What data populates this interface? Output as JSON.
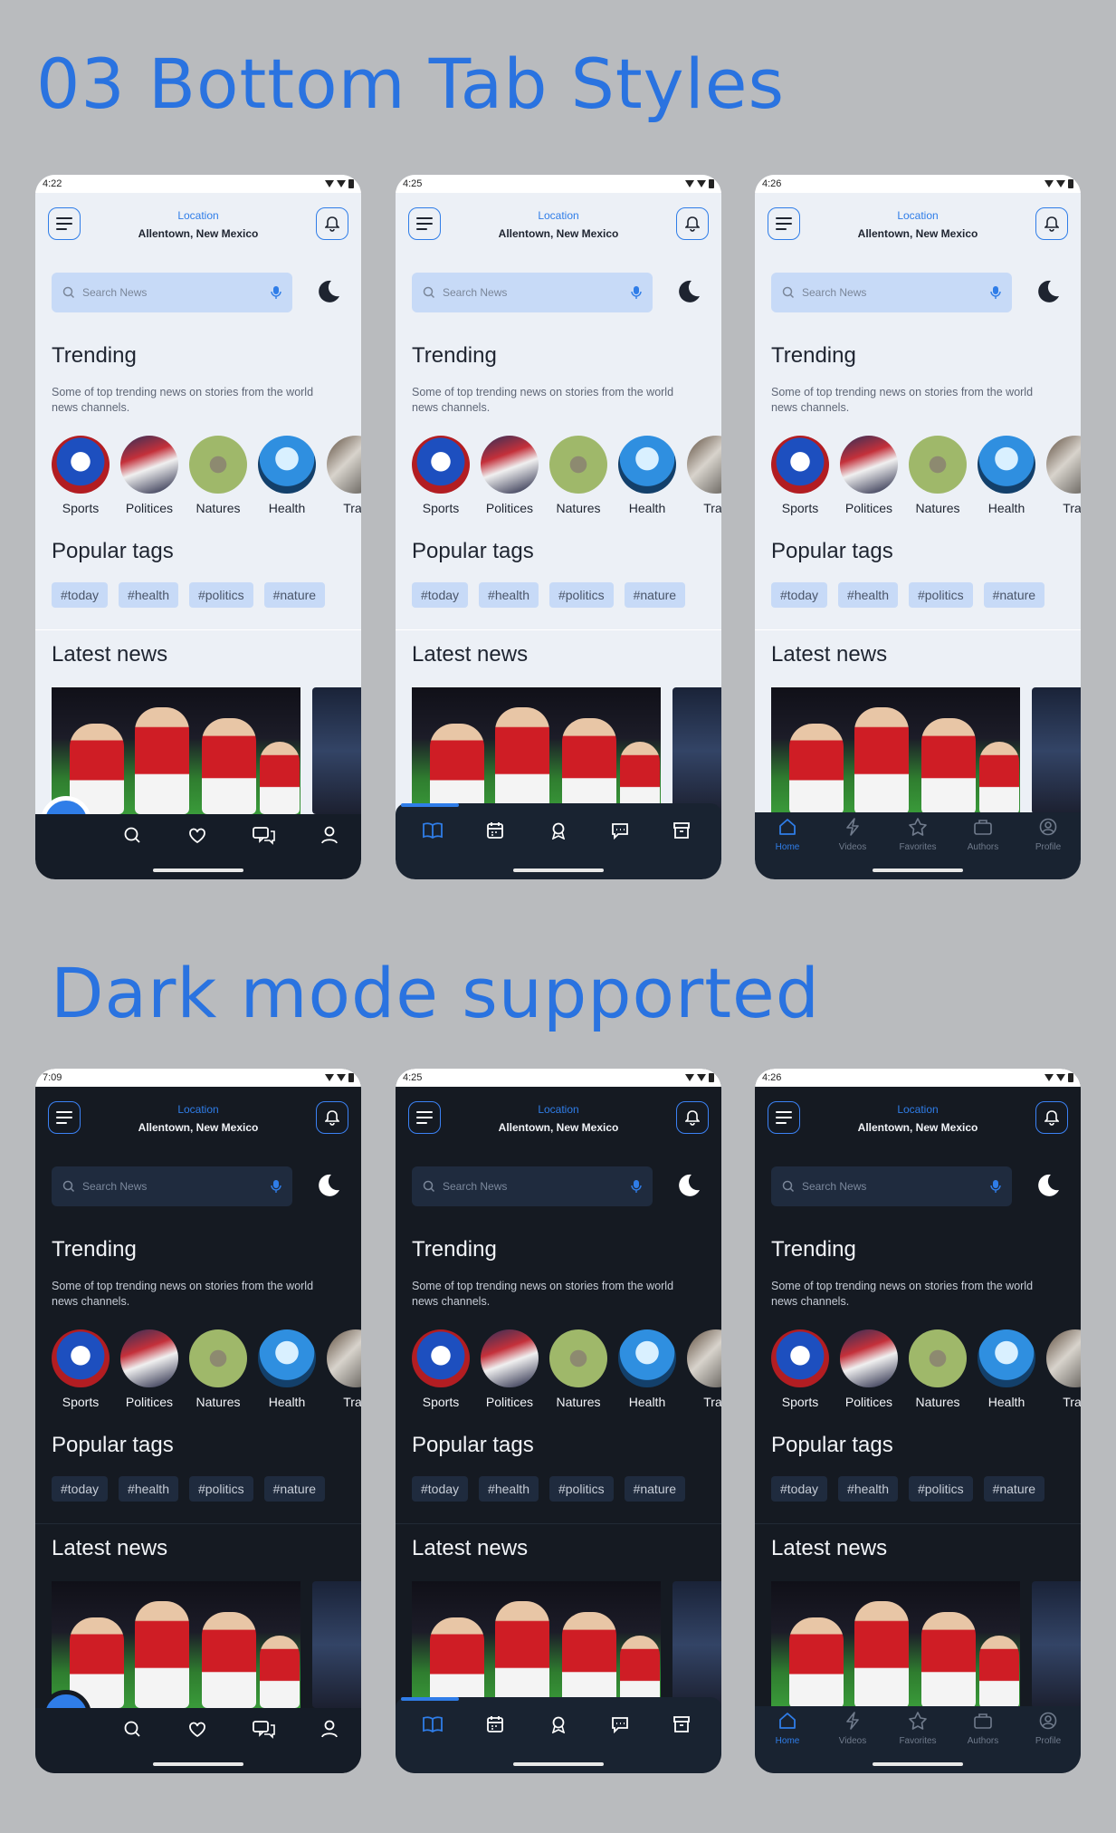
{
  "headings": {
    "tab_styles": "03 Bottom Tab Styles",
    "dark_mode": "Dark mode supported"
  },
  "screens": [
    {
      "time": "4:22"
    },
    {
      "time": "4:25"
    },
    {
      "time": "4:26"
    },
    {
      "time": "7:09"
    },
    {
      "time": "4:25"
    },
    {
      "time": "4:26"
    }
  ],
  "header": {
    "location_label": "Location",
    "location_value": "Allentown, New Mexico"
  },
  "search": {
    "placeholder": "Search News"
  },
  "trending": {
    "title": "Trending",
    "subtitle": "Some of top trending news on stories from the world news channels."
  },
  "categories": [
    "Sports",
    "Politices",
    "Natures",
    "Health",
    "Trav"
  ],
  "popular": {
    "title": "Popular tags",
    "tags": [
      "#today",
      "#health",
      "#politics",
      "#nature"
    ]
  },
  "latest": {
    "title": "Latest news"
  },
  "tabs_style3": [
    "Home",
    "Videos",
    "Favorites",
    "Authors",
    "Profile"
  ],
  "colors": {
    "accent": "#2f7de8",
    "light_bg": "#ecf0f6",
    "dark_bg": "#151a22",
    "nav_bg": "#192331",
    "heading": "#2a73e0",
    "page_bg": "#b9bbbe"
  },
  "icons": {
    "style1": [
      "home-icon",
      "search-icon",
      "heart-icon",
      "chat-icon",
      "user-icon"
    ],
    "style2": [
      "book-icon",
      "calendar-icon",
      "badge-icon",
      "message-icon",
      "archive-icon"
    ],
    "style3": [
      "home-icon",
      "bolt-icon",
      "star-icon",
      "bag-icon",
      "profile-icon"
    ]
  }
}
